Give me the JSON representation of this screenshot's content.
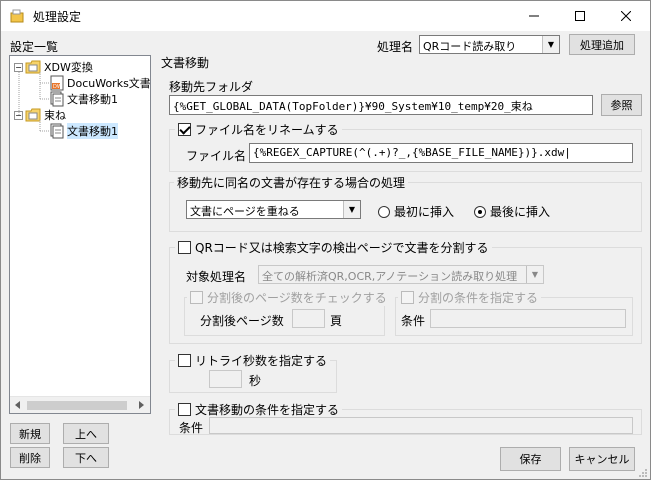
{
  "window": {
    "title": "処理設定"
  },
  "left": {
    "section_label": "設定一覧",
    "tree": [
      {
        "label": "XDW変換",
        "level": 0,
        "kind": "folder"
      },
      {
        "label": "DocuWorks文書変換",
        "level": 1,
        "kind": "docuworks"
      },
      {
        "label": "文書移動1",
        "level": 1,
        "kind": "doc"
      },
      {
        "label": "束ね",
        "level": 0,
        "kind": "folder"
      },
      {
        "label": "文書移動1",
        "level": 1,
        "kind": "doc",
        "selected": true
      }
    ],
    "buttons": {
      "new": "新規",
      "up": "上へ",
      "delete": "削除",
      "down": "下へ"
    }
  },
  "top": {
    "process_name_label": "処理名",
    "process_name_value": "QRコード読み取り",
    "add_process_button": "処理追加"
  },
  "main": {
    "heading": "文書移動",
    "dest_folder_label": "移動先フォルダ",
    "dest_folder_value": "{%GET_GLOBAL_DATA(TopFolder)}¥90_System¥10_temp¥20_束ね",
    "browse_button": "参照",
    "rename": {
      "legend": "ファイル名をリネームする",
      "checked": true,
      "filename_label": "ファイル名",
      "filename_value": "{%REGEX_CAPTURE(^(.+)?_,{%BASE_FILE_NAME})}.xdw|"
    },
    "conflict": {
      "legend": "移動先に同名の文書が存在する場合の処理",
      "select_value": "文書にページを重ねる",
      "radio_first": "最初に挿入",
      "radio_last": "最後に挿入",
      "selected": "last"
    },
    "split": {
      "legend": "QRコード又は検索文字の検出ページで文書を分割する",
      "checked": false,
      "target_label": "対象処理名",
      "target_value": "全ての解析済QR,OCR,アノテーション読み取り処理",
      "page_check_legend": "分割後のページ数をチェックする",
      "page_count_label": "分割後ページ数",
      "page_unit": "頁",
      "condition_legend": "分割の条件を指定する",
      "condition_label": "条件"
    },
    "retry": {
      "legend": "リトライ秒数を指定する",
      "checked": false,
      "unit": "秒"
    },
    "move_condition": {
      "legend": "文書移動の条件を指定する",
      "checked": false,
      "condition_label": "条件"
    }
  },
  "footer": {
    "save": "保存",
    "cancel": "キャンセル"
  }
}
